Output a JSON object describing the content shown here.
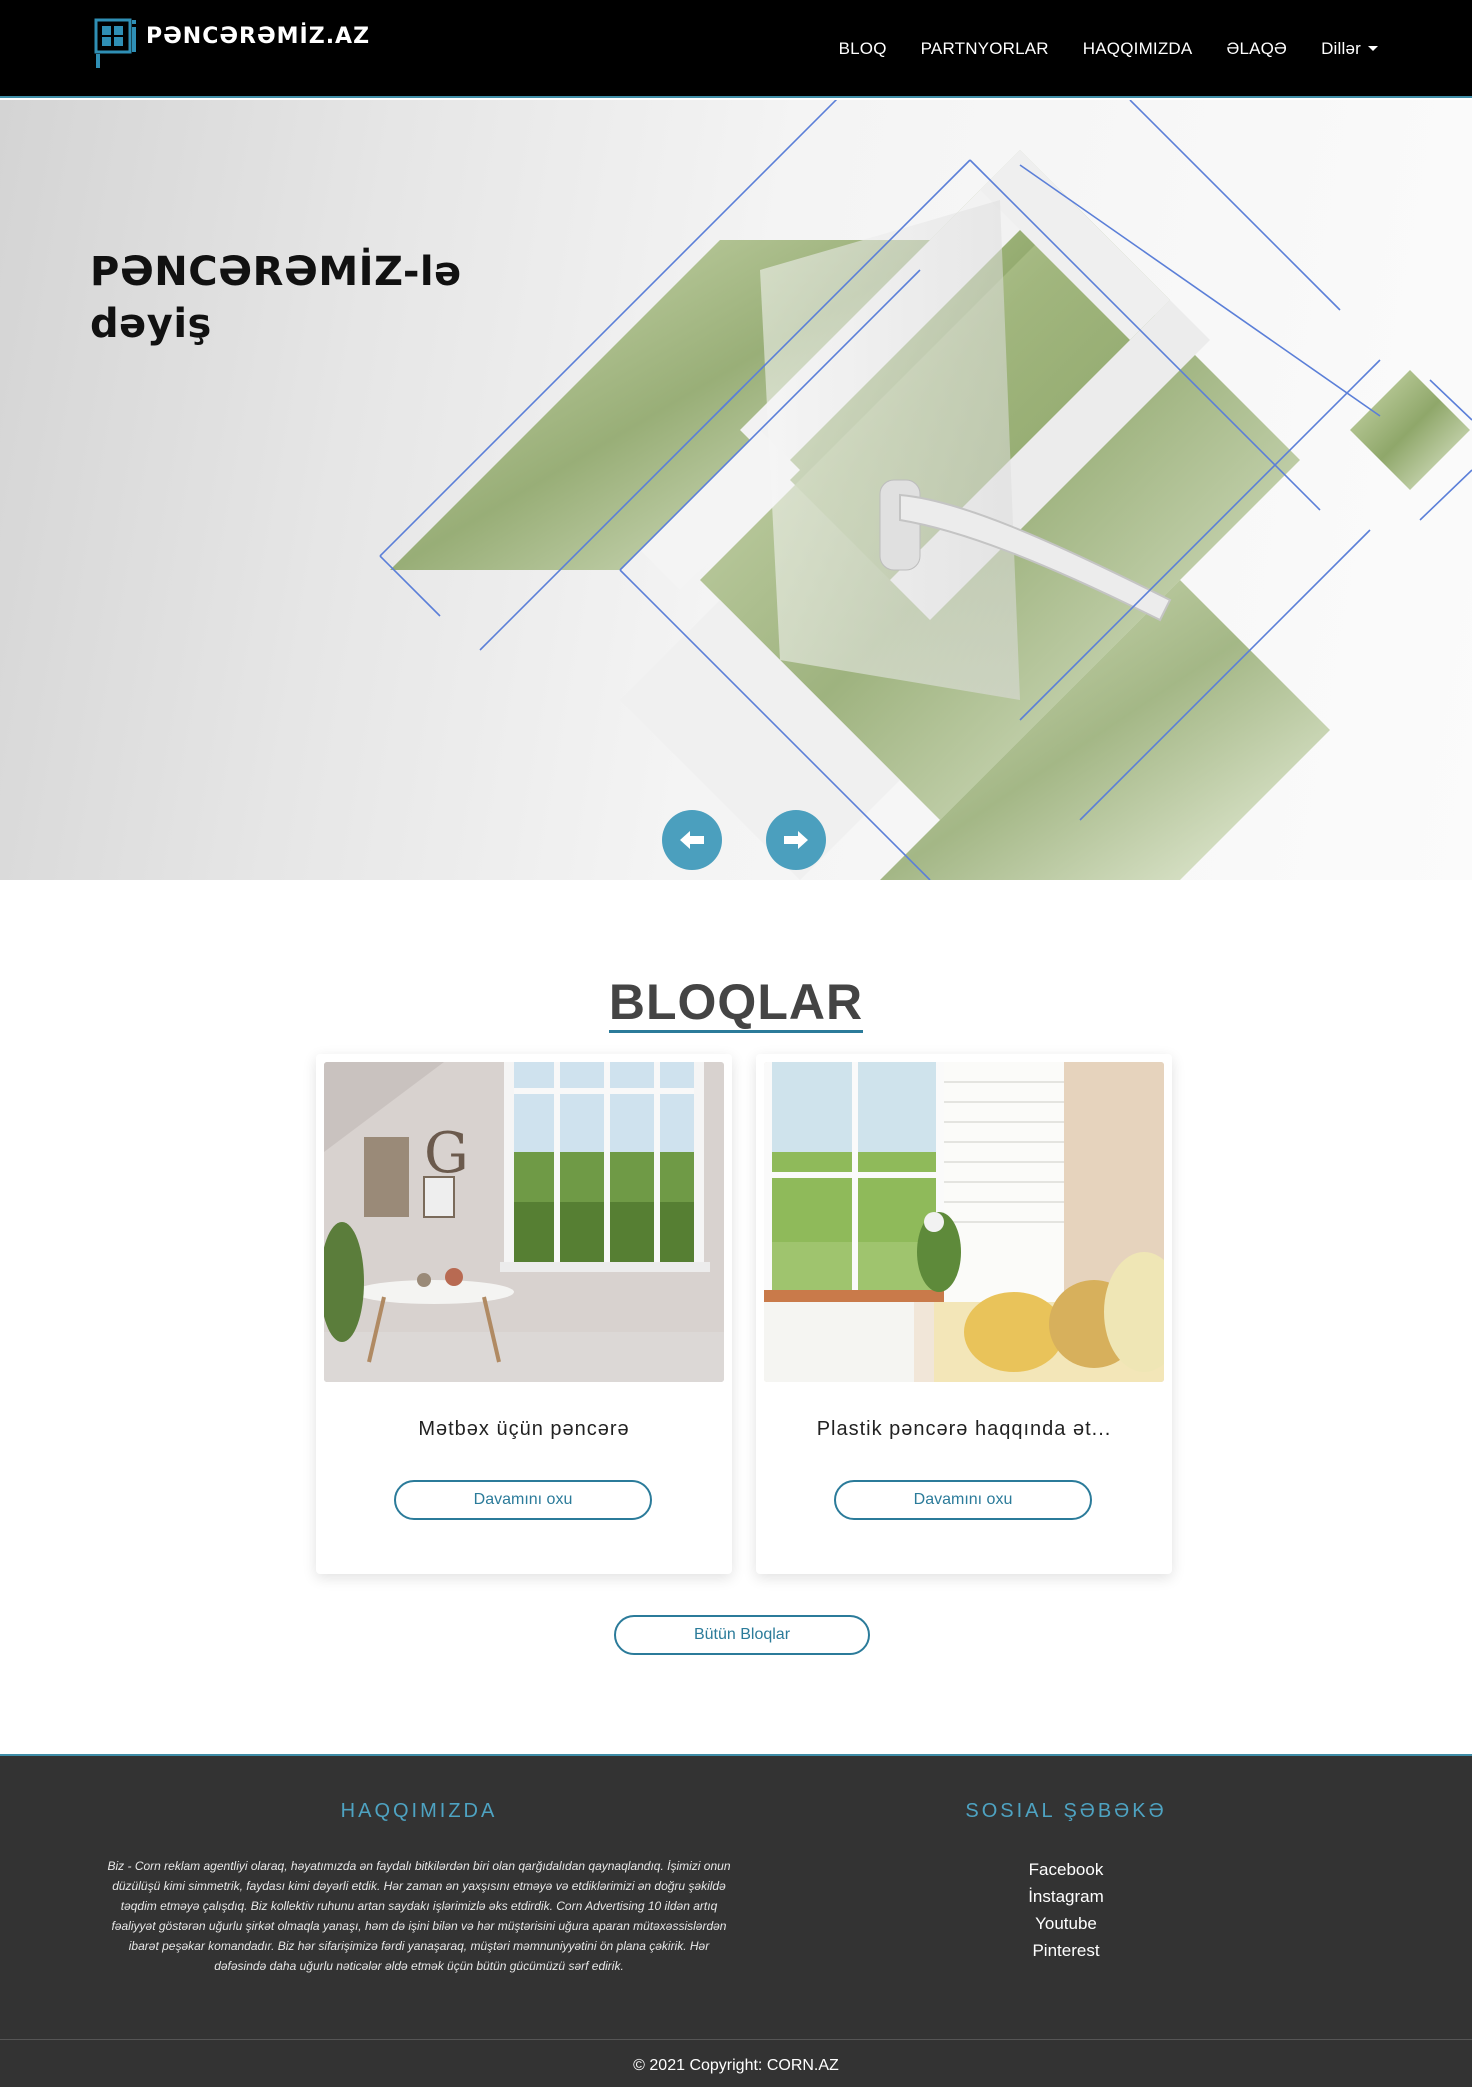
{
  "navbar": {
    "brand": "PƏNCƏRƏMİZ.AZ",
    "links": [
      {
        "label": "BLOQ"
      },
      {
        "label": "PARTNYORLAR"
      },
      {
        "label": "HAQQIMIZDA"
      },
      {
        "label": "ƏLAQƏ"
      }
    ],
    "languages_label": "Dillər"
  },
  "hero": {
    "title_line1": "PƏNCƏRƏMİZ-lə",
    "title_line2": "dəyiş",
    "prev_icon": "arrow-left-icon",
    "next_icon": "arrow-right-icon"
  },
  "blog": {
    "title": "BLOQLAR",
    "cards": [
      {
        "title": "Mətbəx üçün pəncərə",
        "button": "Davamını oxu"
      },
      {
        "title": "Plastik pəncərə haqqında ət...",
        "button": "Davamını oxu"
      }
    ],
    "all_button": "Bütün Bloqlar"
  },
  "footer": {
    "about_heading": "HAQQIMIZDA",
    "about_text": "Biz - Corn reklam agentliyi olaraq, həyatımızda ən faydalı bitkilərdən biri olan qarğıdalıdan qaynaqlandıq. İşimizi onun düzülüşü kimi simmetrik, faydası kimi dəyərli etdik. Hər zaman ən yaxşısını etməyə və etdiklərimizi ən doğru şəkildə təqdim etməyə çalışdıq. Biz kollektiv ruhunu artan saydakı işlərimizlə əks etdirdik. Corn Advertising 10 ildən artıq fəaliyyət göstərən uğurlu şirkət olmaqla yanaşı, həm də işini bilən və hər müştərisini uğura aparan mütəxəssislərdən ibarət peşəkar komandadır. Biz hər sifarişimizə fərdi yanaşaraq, müştəri məmnuniyyətini ön plana çəkirik. Hər dəfəsində daha uğurlu nəticələr əldə etmək üçün bütün gücümüzü sərf edirik.",
    "social_heading": "SOSIAL ŞƏBƏKƏ",
    "social_links": [
      {
        "label": "Facebook"
      },
      {
        "label": "İnstagram"
      },
      {
        "label": "Youtube"
      },
      {
        "label": "Pinterest"
      }
    ],
    "copyright": "© 2021 Copyright: CORN.AZ"
  },
  "colors": {
    "navbar_bg": "#000000",
    "accent": "#2b7b9a",
    "carousel_button": "#4b9fbe",
    "footer_bg": "#333333",
    "footer_heading": "#4ea3c2"
  }
}
